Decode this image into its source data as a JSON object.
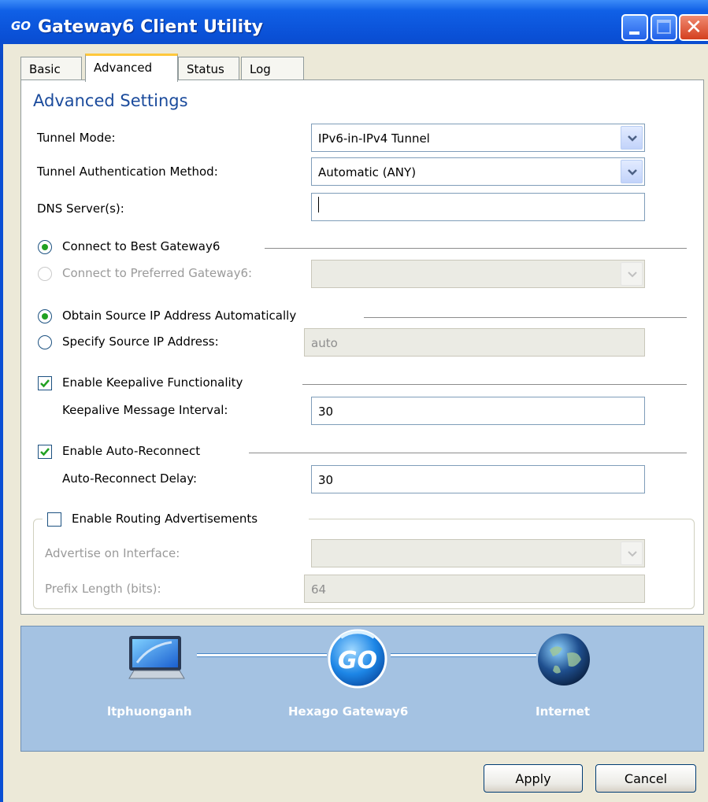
{
  "window": {
    "logo_text": "GO",
    "title": "Gateway6 Client Utility"
  },
  "tabs": [
    {
      "label": "Basic"
    },
    {
      "label": "Advanced",
      "active": true
    },
    {
      "label": "Status"
    },
    {
      "label": "Log"
    }
  ],
  "heading": "Advanced Settings",
  "tunnel_mode": {
    "label": "Tunnel Mode:",
    "value": "IPv6-in-IPv4 Tunnel"
  },
  "auth_method": {
    "label": "Tunnel Authentication Method:",
    "value": "Automatic (ANY)"
  },
  "dns": {
    "label": "DNS Server(s):",
    "value": ""
  },
  "gateway": {
    "best_label": "Connect to Best Gateway6",
    "best_selected": true,
    "preferred_label": "Connect to Preferred Gateway6:",
    "preferred_value": ""
  },
  "source_ip": {
    "auto_label": "Obtain Source IP Address Automatically",
    "auto_selected": true,
    "specify_label": "Specify Source IP Address:",
    "specify_value": "auto"
  },
  "keepalive": {
    "enable_label": "Enable Keepalive Functionality",
    "enabled": true,
    "interval_label": "Keepalive Message Interval:",
    "interval_value": "30"
  },
  "auto_reconnect": {
    "enable_label": "Enable Auto-Reconnect",
    "enabled": true,
    "delay_label": "Auto-Reconnect Delay:",
    "delay_value": "30"
  },
  "routing": {
    "enable_label": "Enable Routing Advertisements",
    "enabled": false,
    "interface_label": "Advertise on Interface:",
    "interface_value": "",
    "prefix_label": "Prefix Length (bits):",
    "prefix_value": "64"
  },
  "banner": {
    "computer_label": "ltphuonganh",
    "gateway_label": "Hexago Gateway6",
    "gateway_logo": "GO",
    "internet_label": "Internet",
    "icons": [
      "monitor-icon",
      "go-logo-icon",
      "globe-icon"
    ]
  },
  "buttons": {
    "apply": "Apply",
    "cancel": "Cancel"
  },
  "colors": {
    "title_bar": "#0a50d6",
    "heading": "#1b4b9c",
    "banner_bg": "#a4c2e2",
    "radio_dot": "#21a121",
    "active_tab_accent": "#ffc83c"
  }
}
